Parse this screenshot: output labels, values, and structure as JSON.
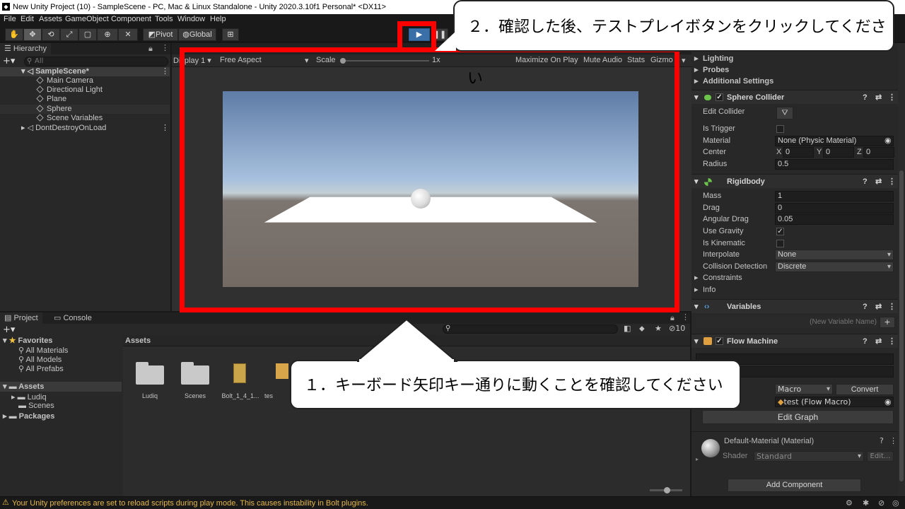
{
  "title_bar": {
    "title": "New Unity Project (10) - SampleScene - PC, Mac & Linux Standalone - Unity 2020.3.10f1 Personal* <DX11>"
  },
  "menu": [
    "File",
    "Edit",
    "Assets",
    "GameObject",
    "Component",
    "Tools",
    "Window",
    "Help"
  ],
  "toolbar": {
    "pivot": "Pivot",
    "global": "Global"
  },
  "hierarchy": {
    "tab": "Hierarchy",
    "search_placeholder": "All",
    "scene": "SampleScene*",
    "items": [
      "Main Camera",
      "Directional Light",
      "Plane",
      "Sphere",
      "Scene Variables"
    ],
    "dontdestroy": "DontDestroyOnLoad"
  },
  "game_view": {
    "display": "Display 1",
    "aspect": "Free Aspect",
    "scale_label": "Scale",
    "scale_value": "1x",
    "maximize": "Maximize On Play",
    "mute": "Mute Audio",
    "stats": "Stats",
    "gizmos": "Gizmo"
  },
  "project": {
    "tab_project": "Project",
    "tab_console": "Console",
    "favorites": "Favorites",
    "fav_items": [
      "All Materials",
      "All Models",
      "All Prefabs"
    ],
    "assets": "Assets",
    "asset_items": [
      "Ludiq",
      "Scenes"
    ],
    "packages": "Packages",
    "breadcrumb": "Assets",
    "hidden_count": "10",
    "grid": [
      "Ludiq",
      "Scenes",
      "Bolt_1_4_1...",
      "tes"
    ]
  },
  "inspector": {
    "lighting": "Lighting",
    "probes": "Probes",
    "additional": "Additional Settings",
    "sphere_collider": {
      "title": "Sphere Collider",
      "edit_collider": "Edit Collider",
      "is_trigger": "Is Trigger",
      "material_label": "Material",
      "material_value": "None (Physic Material)",
      "center_label": "Center",
      "x": "X",
      "x_val": "0",
      "y": "Y",
      "y_val": "0",
      "z": "Z",
      "z_val": "0",
      "radius_label": "Radius",
      "radius_val": "0.5"
    },
    "rigidbody": {
      "title": "Rigidbody",
      "mass_label": "Mass",
      "mass_val": "1",
      "drag_label": "Drag",
      "drag_val": "0",
      "angular_label": "Angular Drag",
      "angular_val": "0.05",
      "gravity_label": "Use Gravity",
      "kinematic_label": "Is Kinematic",
      "interpolate_label": "Interpolate",
      "interpolate_val": "None",
      "collision_label": "Collision Detection",
      "collision_val": "Discrete",
      "constraints": "Constraints",
      "info": "Info"
    },
    "variables": {
      "title": "Variables",
      "new_placeholder": "(New Variable Name)"
    },
    "flow_machine": {
      "title": "Flow Machine",
      "source_val": "Macro",
      "convert": "Convert",
      "macro_val": "test (Flow Macro)",
      "edit_graph": "Edit Graph"
    },
    "material": {
      "title": "Default-Material (Material)",
      "shader_label": "Shader",
      "shader_val": "Standard",
      "edit": "Edit..."
    },
    "add_component": "Add Component"
  },
  "status_bar": {
    "message": "Your Unity preferences are set to reload scripts during play mode. This causes instability in Bolt plugins."
  },
  "callouts": {
    "step2": "２．確認した後、テストプレイボタンをクリックしてください",
    "step1": "１．キーボード矢印キー通りに動くことを確認してください"
  },
  "colors": {
    "highlight_red": "#ff0000",
    "play_blue": "#3a6fa8"
  }
}
